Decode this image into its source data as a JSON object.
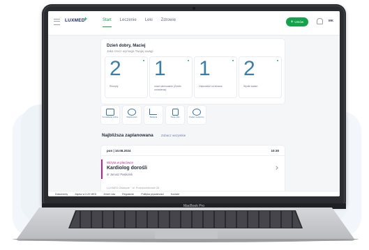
{
  "app": {
    "logo_text": "LUXMED",
    "logo_cross": "+"
  },
  "nav": {
    "items": [
      "Start",
      "Leczenie",
      "Leki",
      "Zdrowie"
    ],
    "active": "Start"
  },
  "header": {
    "cta_label": "Umów",
    "avatar_initials": "MK"
  },
  "greeting": {
    "title": "Dzień dobry, Maciej",
    "subtitle": "Jaka rzecz wymaga Twojej uwagi"
  },
  "stats": [
    {
      "value": "2",
      "label": "Recepty"
    },
    {
      "value": "1",
      "label": "nowe skierowanie (Źródło umówienia)"
    },
    {
      "value": "1",
      "label": "Odpowiedź od lekarza"
    },
    {
      "value": "2",
      "label": "Wyniki badań"
    }
  ],
  "quick_actions": [
    "Konsultacja online",
    "Wiadomości",
    "Badania",
    "Twoje pliki",
    "Pakiet medyczny"
  ],
  "upcoming": {
    "title": "Najbliższa zaplanowana",
    "see_all": "Zobacz wszystkie",
    "date": "pon | 10.08.2024",
    "time": "10:30",
    "type": "Wizyta w placówce",
    "specialty": "Kardiolog dorośli",
    "doctor": "dr Janusz Pasikonik",
    "place": "LUXMED Zabłocie · ul. Przewoźnikowa 26"
  },
  "footer": {
    "links": [
      "Dokumenty",
      "Zapisz w LUX MED",
      "Zmień nas",
      "Regulamin",
      "Polityka prywatności",
      "Kontakt"
    ]
  },
  "device": {
    "label": "MacBook Pro"
  },
  "colors": {
    "brand_green": "#14a34a",
    "brand_navy": "#1b2a6b",
    "stat_blue": "#3b7ea8",
    "visit_magenta": "#c0248a"
  }
}
